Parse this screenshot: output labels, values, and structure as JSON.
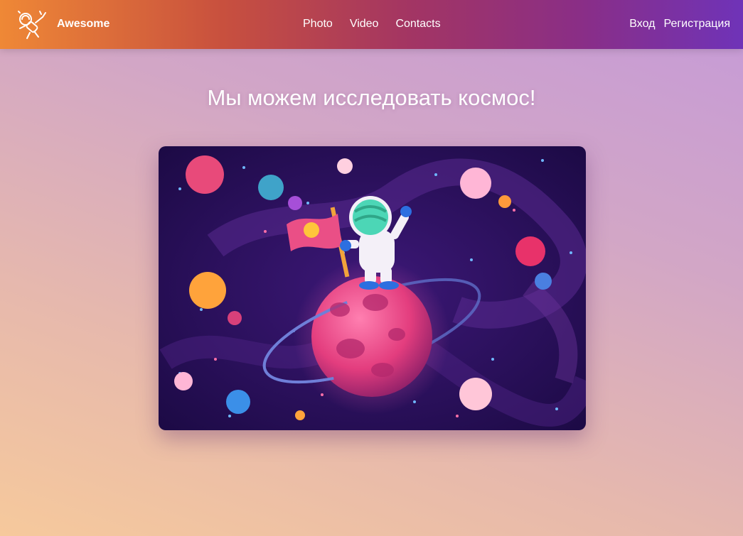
{
  "header": {
    "brand": "Awesome",
    "logo_icon": "astronaut-icon",
    "nav": [
      {
        "label": "Photo"
      },
      {
        "label": "Video"
      },
      {
        "label": "Contacts"
      }
    ],
    "auth": {
      "login": "Вход",
      "register": "Регистрация"
    }
  },
  "main": {
    "title": "Мы можем исследовать космос!",
    "hero_image": "astronaut-planet-illustration"
  },
  "colors": {
    "header_start": "#ef8836",
    "header_end": "#6f33b8",
    "space_bg": "#2a0f5a"
  }
}
